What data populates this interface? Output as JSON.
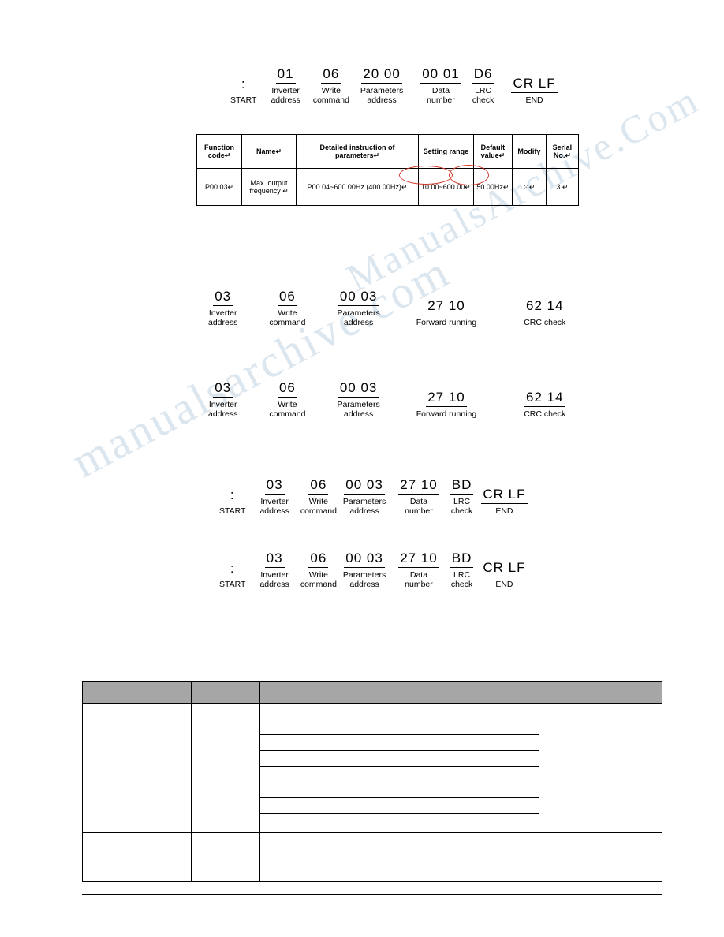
{
  "watermark": {
    "line1": "manualsarchive.com",
    "line2": "ManualsArchive.Com"
  },
  "sequences": [
    {
      "name": "lrc-frame-p0003-write",
      "fields": [
        {
          "hex": ":",
          "label": "START",
          "underline": false
        },
        {
          "hex": "01",
          "label": "Inverter\naddress",
          "underline": true
        },
        {
          "hex": "06",
          "label": "Write\ncommand",
          "underline": true
        },
        {
          "hex": "20 00",
          "label": "Parameters\naddress",
          "underline": true
        },
        {
          "hex": "00 01",
          "label": "Data\nnumber",
          "underline": true
        },
        {
          "hex": "D6",
          "label": "LRC\ncheck",
          "underline": true
        },
        {
          "hex": "CR LF",
          "label": "END",
          "underline": true
        }
      ]
    },
    {
      "name": "crc-frame-request",
      "fields": [
        {
          "hex": "03",
          "label": "Inverter\naddress",
          "underline": true
        },
        {
          "hex": "06",
          "label": "Write\ncommand",
          "underline": true
        },
        {
          "hex": "00 03",
          "label": "Parameters\naddress",
          "underline": true
        },
        {
          "hex": "27 10",
          "label": "Forward running",
          "underline": true
        },
        {
          "hex": "62 14",
          "label": "CRC  check",
          "underline": true
        }
      ]
    },
    {
      "name": "crc-frame-response",
      "fields": [
        {
          "hex": "03",
          "label": "Inverter\naddress",
          "underline": true
        },
        {
          "hex": "06",
          "label": "Write\ncommand",
          "underline": true
        },
        {
          "hex": "00 03",
          "label": "Parameters\naddress",
          "underline": true
        },
        {
          "hex": "27 10",
          "label": "Forward running",
          "underline": true
        },
        {
          "hex": "62 14",
          "label": "CRC  check",
          "underline": true
        }
      ]
    },
    {
      "name": "lrc-frame-request",
      "fields": [
        {
          "hex": ":",
          "label": "START",
          "underline": false
        },
        {
          "hex": "03",
          "label": "Inverter\naddress",
          "underline": true
        },
        {
          "hex": "06",
          "label": "Write\ncommand",
          "underline": true
        },
        {
          "hex": "00 03",
          "label": "Parameters\naddress",
          "underline": true
        },
        {
          "hex": "27 10",
          "label": "Data\nnumber",
          "underline": true
        },
        {
          "hex": "BD",
          "label": "LRC\ncheck",
          "underline": true
        },
        {
          "hex": "CR LF",
          "label": "END",
          "underline": true
        }
      ]
    },
    {
      "name": "lrc-frame-response",
      "fields": [
        {
          "hex": ":",
          "label": "START",
          "underline": false
        },
        {
          "hex": "03",
          "label": "Inverter\naddress",
          "underline": true
        },
        {
          "hex": "06",
          "label": "Write\ncommand",
          "underline": true
        },
        {
          "hex": "00 03",
          "label": "Parameters\naddress",
          "underline": true
        },
        {
          "hex": "27 10",
          "label": "Data\nnumber",
          "underline": true
        },
        {
          "hex": "BD",
          "label": "LRC\ncheck",
          "underline": true
        },
        {
          "hex": "CR LF",
          "label": "END",
          "underline": true
        }
      ]
    }
  ],
  "param_table": {
    "headers": [
      "Function code↵",
      "Name↵",
      "Detailed instruction of parameters↵",
      "Setting range",
      "Default value↵",
      "Modify",
      "Serial No.↵"
    ],
    "row": {
      "code": "P00.03↵",
      "name": "Max. output frequency ↵",
      "detail": "P00.04~600.00Hz (400.00Hz)↵",
      "range": "10.00~600.00↵",
      "default": "50.00Hz↵",
      "modify": "⊙↵",
      "serial": "3.↵"
    },
    "highlight_color": "#d33a2c"
  },
  "bottom_table": {
    "header_color": "#a6a6a6",
    "header_cells": [
      "",
      "",
      "",
      ""
    ],
    "rows": [
      [
        "",
        "",
        "",
        ""
      ],
      [
        "",
        "",
        "",
        ""
      ],
      [
        "",
        "",
        "",
        ""
      ],
      [
        "",
        "",
        "",
        ""
      ],
      [
        "",
        "",
        "",
        ""
      ],
      [
        "",
        "",
        "",
        ""
      ],
      [
        "",
        "",
        "",
        ""
      ],
      [
        "",
        "",
        "",
        ""
      ]
    ]
  }
}
